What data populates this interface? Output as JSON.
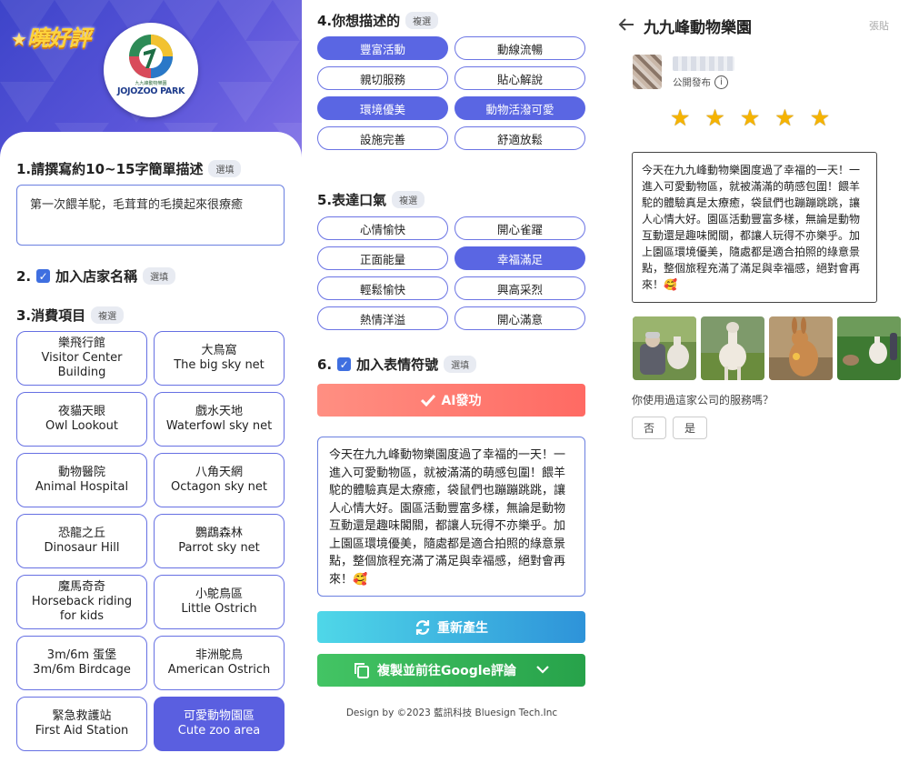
{
  "brand": {
    "name": "曉好評"
  },
  "logo": {
    "sub": "九九峰動物樂園",
    "name": "JOJOZOO PARK"
  },
  "section1": {
    "title": "1.請撰寫約10~15字簡單描述",
    "tag": "選填",
    "text": "第一次餵羊駝，毛茸茸的毛摸起來很療癒"
  },
  "section2": {
    "prefix": "2.",
    "title": "加入店家名稱",
    "tag": "選填"
  },
  "section3": {
    "title": "3.消費項目",
    "tag": "複選",
    "items": [
      {
        "zh": "樂飛行館",
        "en1": "Visitor Center",
        "en2": "Building",
        "selected": false
      },
      {
        "zh": "大鳥窩",
        "en1": "The big sky net",
        "en2": "",
        "selected": false
      },
      {
        "zh": "夜貓天眼",
        "en1": "Owl Lookout",
        "en2": "",
        "selected": false
      },
      {
        "zh": "戲水天地",
        "en1": "Waterfowl sky net",
        "en2": "",
        "selected": false
      },
      {
        "zh": "動物醫院",
        "en1": "Animal Hospital",
        "en2": "",
        "selected": false
      },
      {
        "zh": "八角天網",
        "en1": "Octagon sky net",
        "en2": "",
        "selected": false
      },
      {
        "zh": "恐龍之丘",
        "en1": "Dinosaur Hill",
        "en2": "",
        "selected": false
      },
      {
        "zh": "鸚鵡森林",
        "en1": "Parrot sky net",
        "en2": "",
        "selected": false
      },
      {
        "zh": "魔馬奇奇",
        "en1": "Horseback riding",
        "en2": "for kids",
        "selected": false
      },
      {
        "zh": "小鴕鳥區",
        "en1": "Little Ostrich",
        "en2": "",
        "selected": false
      },
      {
        "zh": "3m/6m 蛋堡",
        "en1": "3m/6m Birdcage",
        "en2": "",
        "selected": false
      },
      {
        "zh": "非洲鴕鳥",
        "en1": "American Ostrich",
        "en2": "",
        "selected": false
      },
      {
        "zh": "緊急救護站",
        "en1": "First Aid Station",
        "en2": "",
        "selected": false
      },
      {
        "zh": "可愛動物園區",
        "en1": "Cute zoo area",
        "en2": "",
        "selected": true
      }
    ]
  },
  "section4": {
    "title": "4.你想描述的",
    "tag": "複選",
    "options": [
      {
        "label": "豐富活動",
        "selected": true
      },
      {
        "label": "動線流暢",
        "selected": false
      },
      {
        "label": "親切服務",
        "selected": false
      },
      {
        "label": "貼心解說",
        "selected": false
      },
      {
        "label": "環境優美",
        "selected": true
      },
      {
        "label": "動物活潑可愛",
        "selected": true
      },
      {
        "label": "設施完善",
        "selected": false
      },
      {
        "label": "舒適放鬆",
        "selected": false
      }
    ]
  },
  "section5": {
    "title": "5.表達口氣",
    "tag": "複選",
    "options": [
      {
        "label": "心情愉快",
        "selected": false
      },
      {
        "label": "開心雀躍",
        "selected": false
      },
      {
        "label": "正面能量",
        "selected": false
      },
      {
        "label": "幸福滿足",
        "selected": true
      },
      {
        "label": "輕鬆愉快",
        "selected": false
      },
      {
        "label": "興高采烈",
        "selected": false
      },
      {
        "label": "熱情洋溢",
        "selected": false
      },
      {
        "label": "開心滿意",
        "selected": false
      }
    ]
  },
  "section6": {
    "prefix": "6.",
    "title": "加入表情符號",
    "tag": "選填"
  },
  "actions": {
    "ai": "AI發功",
    "regenerate": "重新產生",
    "copy": "複製並前往Google評論"
  },
  "generated_text": "今天在九九峰動物樂園度過了幸福的一天！一進入可愛動物區，就被滿滿的萌感包圍！餵羊駝的體驗真是太療癒，袋鼠們也蹦蹦跳跳，讓人心情大好。園區活動豐富多樣，無論是動物互動還是趣味閣關，都讓人玩得不亦樂乎。加上園區環境優美，隨處都是適合拍照的綠意景點，整個旅程充滿了滿足與幸福感，絕對會再來！🥰",
  "footer": "Design by ©2023 藍訊科技 Bluesign Tech.Inc",
  "review": {
    "title": "九九峰動物樂園",
    "post": "張貼",
    "visibility": "公開發布",
    "rating": 5,
    "text": "今天在九九峰動物樂園度過了幸福的一天！一進入可愛動物區，就被滿滿的萌感包圍！餵羊駝的體驗真是太療癒，袋鼠們也蹦蹦跳跳，讓人心情大好。園區活動豐富多樣，無論是動物互動還是趣味闖關，都讓人玩得不亦樂乎。加上園區環境優美，隨處都是適合拍照的綠意景點，整個旅程充滿了滿足與幸福感，絕對會再來！🥰",
    "question": "你使用過這家公司的服務嗎？",
    "no": "否",
    "yes": "是"
  },
  "colors": {
    "accent": "#5a5fe0",
    "ai": "#ff7a70",
    "regen": "#2e93d9",
    "copy": "#2fae52",
    "star": "#f5b301"
  }
}
